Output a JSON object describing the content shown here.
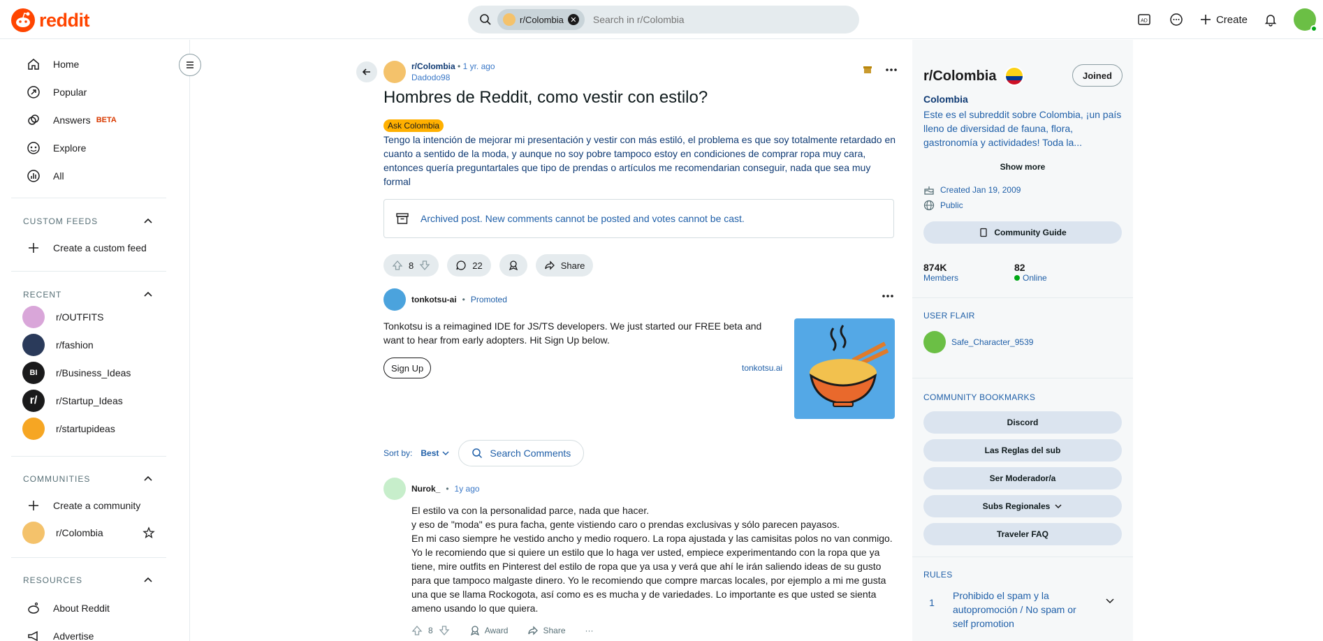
{
  "header": {
    "logo_text": "reddit",
    "search_chip": "r/Colombia",
    "search_placeholder": "Search in r/Colombia",
    "create_label": "Create"
  },
  "left_nav": {
    "items": [
      {
        "label": "Home",
        "icon": "home-icon"
      },
      {
        "label": "Popular",
        "icon": "popular-icon"
      },
      {
        "label": "Answers",
        "icon": "answers-icon",
        "badge": "BETA"
      },
      {
        "label": "Explore",
        "icon": "explore-icon"
      },
      {
        "label": "All",
        "icon": "all-icon"
      }
    ],
    "custom_feeds": {
      "title": "CUSTOM FEEDS",
      "create": "Create a custom feed"
    },
    "recent": {
      "title": "RECENT",
      "items": [
        "r/OUTFITS",
        "r/fashion",
        "r/Business_Ideas",
        "r/Startup_Ideas",
        "r/startupideas"
      ]
    },
    "communities": {
      "title": "COMMUNITIES",
      "create": "Create a community",
      "items": [
        "r/Colombia"
      ]
    },
    "resources": {
      "title": "RESOURCES",
      "items": [
        "About Reddit",
        "Advertise"
      ]
    }
  },
  "post": {
    "subreddit": "r/Colombia",
    "time": "1 yr. ago",
    "author": "Dadodo98",
    "title": "Hombres de Reddit, como vestir con estilo?",
    "flair": "Ask Colombia",
    "body": "Tengo la intención de mejorar mi presentación y vestir con más estiló, el problema es que soy totalmente retardado en cuanto a sentido de la moda, y aunque no soy pobre tampoco estoy en condiciones de comprar ropa muy cara, entonces quería preguntartales que tipo de prendas o artículos me recomendarian conseguir, nada que sea muy formal",
    "archived_notice": "Archived post. New comments cannot be posted and votes cannot be cast.",
    "votes": "8",
    "comments": "22",
    "share": "Share"
  },
  "promo": {
    "author": "tonkotsu-ai",
    "tag": "Promoted",
    "text": "Tonkotsu is a reimagined IDE for JS/TS developers. We just started our FREE beta and want to hear from early adopters. Hit Sign Up below.",
    "cta": "Sign Up",
    "link": "tonkotsu.ai"
  },
  "comments_bar": {
    "sort_by": "Sort by:",
    "sort_value": "Best",
    "search": "Search Comments"
  },
  "comment": {
    "author": "Nurok_",
    "time": "1y ago",
    "lines": [
      "El estilo va con la personalidad parce, nada que hacer.",
      "y eso de \"moda\" es pura facha, gente vistiendo caro o prendas exclusivas y sólo parecen payasos.",
      "En mi caso siempre he vestido ancho y medio roquero. La ropa ajustada y las camisitas polos no van conmigo.",
      "Yo le recomiendo que si quiere un estilo que lo haga ver usted, empiece experimentando con la ropa que ya tiene, mire outfits en Pinterest del estilo de ropa que ya usa y verá que ahí le irán saliendo ideas de su gusto para que tampoco malgaste dinero. Yo le recomiendo que compre marcas locales, por ejemplo a mi me gusta una que se llama Rockogota, así como es es mucha y de variedades. Lo importante es que usted se sienta ameno usando lo que quiera."
    ],
    "votes": "8",
    "award": "Award",
    "share": "Share",
    "more": "···"
  },
  "sidebar": {
    "title": "r/Colombia",
    "joined": "Joined",
    "name": "Colombia",
    "description": "Este es el subreddit sobre Colombia, ¡un país lleno de diversidad de fauna, flora, gastronomía y actividades! Toda la...",
    "show_more": "Show more",
    "created": "Created Jan 19, 2009",
    "visibility": "Public",
    "guide": "Community Guide",
    "members_count": "874K",
    "members_label": "Members",
    "online_count": "82",
    "online_label": "Online",
    "user_flair_title": "USER FLAIR",
    "user_flair_name": "Safe_Character_9539",
    "bookmarks_title": "COMMUNITY BOOKMARKS",
    "bookmarks": [
      "Discord",
      "Las Reglas del sub",
      "Ser Moderador/a",
      "Subs Regionales",
      "Traveler FAQ"
    ],
    "rules_title": "RULES",
    "rule_1_num": "1",
    "rule_1_text": "Prohibido el spam y la autopromoción / No spam or self promotion"
  }
}
